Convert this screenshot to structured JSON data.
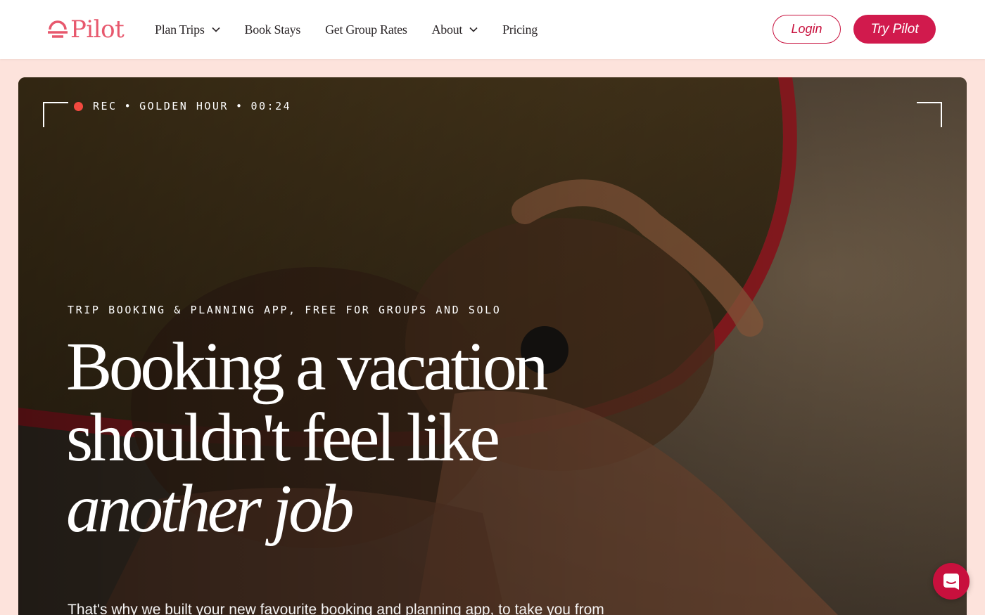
{
  "brand": {
    "name": "Pilot",
    "color": "#e7586d",
    "icon": "sunset-logo-icon"
  },
  "nav": {
    "items": [
      {
        "label": "Plan Trips",
        "has_dropdown": true
      },
      {
        "label": "Book Stays",
        "has_dropdown": false
      },
      {
        "label": "Get Group Rates",
        "has_dropdown": false
      },
      {
        "label": "About",
        "has_dropdown": true
      },
      {
        "label": "Pricing",
        "has_dropdown": false
      }
    ],
    "login_label": "Login",
    "cta_label": "Try Pilot",
    "accent_color": "#d11a4d"
  },
  "hero": {
    "rec_label": "REC",
    "rec_mode": "GOLDEN HOUR",
    "rec_time": "00:24",
    "separator": "•",
    "eyebrow": "TRIP BOOKING & PLANNING APP, FREE FOR GROUPS AND SOLO",
    "headline_line1": "Booking a vacation",
    "headline_line2": "shouldn't feel like",
    "headline_line3": "another job",
    "subtext": "That's why we built your new favourite booking and planning app, to take you from",
    "background_image": "two women lying on beach sand beside a surfboard at golden hour"
  },
  "chat": {
    "icon": "chat-icon"
  }
}
